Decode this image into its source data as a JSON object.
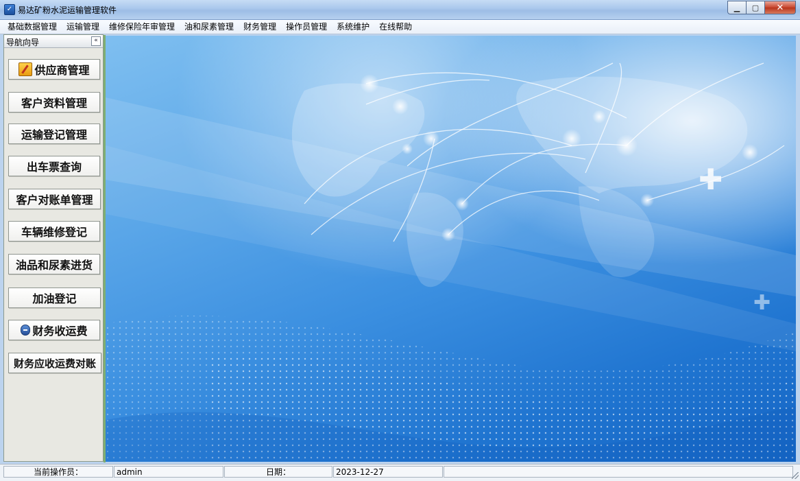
{
  "window": {
    "title": "易达矿粉水泥运输管理软件",
    "controls": {
      "minimize": "▁",
      "maximize": "▢",
      "close": "✕"
    }
  },
  "menu": [
    "基础数据管理",
    "运输管理",
    "维修保险年审管理",
    "油和尿素管理",
    "财务管理",
    "操作员管理",
    "系统维护",
    "在线帮助"
  ],
  "nav": {
    "title": "导航向导",
    "collapse_symbol": "«",
    "buttons": [
      {
        "label": "供应商管理",
        "icon": "edit-icon"
      },
      {
        "label": "客户资料管理"
      },
      {
        "label": "运输登记管理"
      },
      {
        "label": "出车票查询"
      },
      {
        "label": "客户对账单管理"
      },
      {
        "label": "车辆维修登记"
      },
      {
        "label": "油品和尿素进货"
      },
      {
        "label": "加油登记"
      },
      {
        "label": "财务收运费",
        "icon": "money-icon"
      },
      {
        "label": "财务应收运费对账"
      }
    ]
  },
  "status": {
    "operator_label": "当前操作员：",
    "operator_value": "admin",
    "date_label": "日期：",
    "date_value": "2023-12-27"
  },
  "decor": {
    "cross_symbol": "✚"
  }
}
